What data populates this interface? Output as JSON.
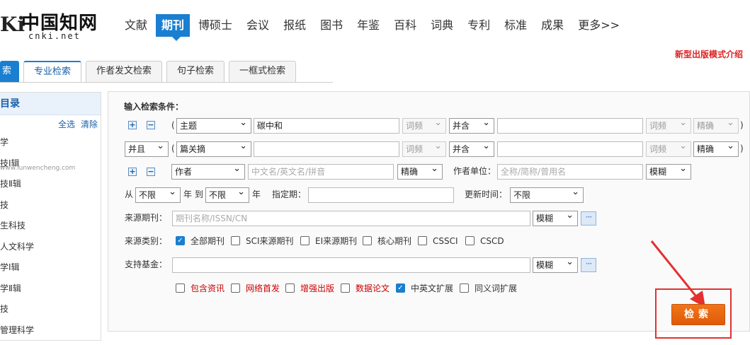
{
  "logo": {
    "mark": "Ki",
    "name": "中国知网",
    "url": "cnki.net"
  },
  "nav": [
    "文献",
    "期刊",
    "博硕士",
    "会议",
    "报纸",
    "图书",
    "年鉴",
    "百科",
    "词典",
    "专利",
    "标准",
    "成果",
    "更多>>"
  ],
  "nav_active_index": 1,
  "intro_link": "新型出版模式介绍",
  "tabs": [
    "索",
    "专业检索",
    "作者发文检索",
    "句子检索",
    "一框式检索"
  ],
  "sidebar": {
    "title": "目录",
    "select_all": "全选",
    "clear": "清除",
    "items": [
      "学",
      "技Ⅰ辑",
      "技Ⅱ辑",
      "技",
      "生科技",
      "人文科学",
      "学Ⅰ辑",
      "学Ⅱ辑",
      "技",
      "管理科学"
    ],
    "watermark": "www.lunwencheng.com"
  },
  "form": {
    "condition_label": "输入检索条件：",
    "row1": {
      "open": "(",
      "field": "主题",
      "value": "碳中和",
      "freq1": "词频",
      "combine": "并含",
      "value2": "",
      "freq2": "词频",
      "match": "精确",
      "close": ")"
    },
    "row2": {
      "logic": "并且",
      "open": "(",
      "field": "篇关摘",
      "value": "",
      "freq1": "词频",
      "combine": "并含",
      "value2": "",
      "freq2": "词频",
      "match": "精确",
      "close": ")"
    },
    "row3": {
      "field": "作者",
      "placeholder": "中文名/英文名/拼音",
      "match": "精确",
      "unit_label": "作者单位：",
      "unit_placeholder": "全称/简称/曾用名",
      "unit_match": "模糊"
    },
    "row4": {
      "from": "从",
      "from_val": "不限",
      "year_to": "年 到",
      "to_val": "不限",
      "year": "年",
      "specified_label": "指定期：",
      "update_label": "更新时间：",
      "update_val": "不限"
    },
    "source": {
      "label": "来源期刊：",
      "placeholder": "期刊名称/ISSN/CN",
      "match": "模糊",
      "more": "···"
    },
    "category": {
      "label": "来源类别：",
      "options": [
        {
          "label": "全部期刊",
          "checked": true
        },
        {
          "label": "SCI来源期刊",
          "checked": false
        },
        {
          "label": "EI来源期刊",
          "checked": false
        },
        {
          "label": "核心期刊",
          "checked": false
        },
        {
          "label": "CSSCI",
          "checked": false
        },
        {
          "label": "CSCD",
          "checked": false
        }
      ]
    },
    "fund": {
      "label": "支持基金：",
      "match": "模糊",
      "more": "···"
    },
    "extras": [
      {
        "label": "包含资讯",
        "checked": false,
        "red": true
      },
      {
        "label": "网络首发",
        "checked": false,
        "red": true
      },
      {
        "label": "增强出版",
        "checked": false,
        "red": true
      },
      {
        "label": "数据论文",
        "checked": false,
        "red": true
      },
      {
        "label": "中英文扩展",
        "checked": true,
        "red": false
      },
      {
        "label": "同义词扩展",
        "checked": false,
        "red": false
      }
    ],
    "search_button": "检索"
  },
  "colors": {
    "brand_blue": "#1a7fd0",
    "search_orange": "#e9670f",
    "highlight_red": "#e53030",
    "link_red": "#d22222"
  }
}
